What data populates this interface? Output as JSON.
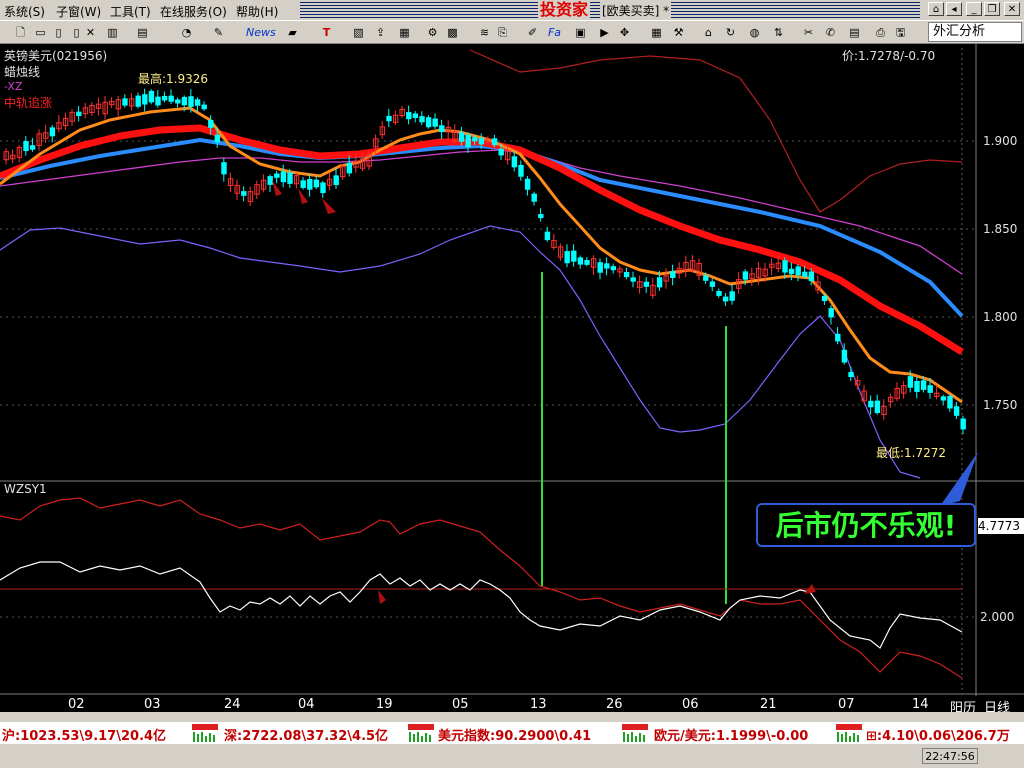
{
  "menu": {
    "items": [
      "系统(S)",
      "子窗(W)",
      "工具(T)",
      "在线服务(O)",
      "帮助(H)"
    ]
  },
  "title": {
    "brand": "投资家",
    "subtitle": "[欧美买卖] *"
  },
  "toolbar": {
    "analysis_select": "外汇分析",
    "news_label": "News",
    "fa_label": "Fa"
  },
  "chart": {
    "symbol": "英镑美元(021956)",
    "style": "蜡烛线",
    "legend_xz": "-XZ",
    "legend_track": "中轨追涨",
    "price_readout": "价:1.7278/-0.70",
    "high_label": "最高:1.9326",
    "low_label": "最低:1.7272",
    "y_ticks": [
      "1.900",
      "1.850",
      "1.800",
      "1.750"
    ],
    "indicator_name": "WZSY1",
    "indicator_value": "4.7773",
    "indicator_tick": "2.000",
    "x_ticks": [
      "02",
      "03",
      "24",
      "04",
      "19",
      "05",
      "13",
      "26",
      "06",
      "21",
      "07",
      "14"
    ],
    "calendar_toggle": "阳历",
    "period": "日线",
    "callout": "后市仍不乐观!",
    "colors": {
      "up": "#ff3030",
      "down": "#00ffff",
      "red_ma": "#ff1010",
      "orange_ma": "#ff8c1a",
      "blue_ma": "#2a8cff",
      "magenta_ma": "#d040d0",
      "band": "#8060ff",
      "upper_band": "#b02020"
    }
  },
  "chart_data": {
    "type": "line",
    "title": "英镑美元(021956)",
    "y_ticks": [
      "1.900",
      "1.850",
      "1.800",
      "1.750"
    ],
    "x_ticks": [
      "02",
      "03",
      "24",
      "04",
      "19",
      "05",
      "13",
      "26",
      "06",
      "21",
      "07",
      "14"
    ],
    "series": [
      {
        "name": "中轨追涨",
        "values": [
          1.88,
          1.895,
          1.905,
          1.893,
          1.885,
          1.89,
          1.88,
          1.855,
          1.83,
          1.82,
          1.79,
          1.76
        ]
      }
    ],
    "high": 1.9326,
    "low": 1.7272,
    "last": 1.7278,
    "change": -0.7
  },
  "ticker": {
    "sh": "沪:1023.53\\9.17\\20.4亿",
    "sz": "深:2722.08\\37.32\\4.5亿",
    "usd": "美元指数:90.2900\\0.41",
    "eur": "欧元/美元:1.1999\\-0.00",
    "last": "⊞:4.10\\0.06\\206.7万"
  },
  "status": {
    "clock": "22:47:56"
  }
}
